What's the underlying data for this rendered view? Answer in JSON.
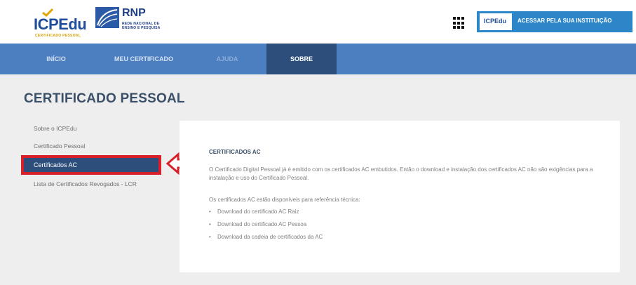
{
  "header": {
    "logo_icp_text": "ICPEdu",
    "logo_icp_sub": "CERTIFICADO PESSOAL",
    "logo_rnp_text": "RNP",
    "logo_rnp_sub1": "REDE NACIONAL DE",
    "logo_rnp_sub2": "ENSINO E PESQUISA",
    "login_logo_text": "ICPEdu",
    "login_label": "ACESSAR PELA SUA INSTITUIÇÃO",
    "grid_icon": "apps-grid-icon"
  },
  "nav": {
    "items": [
      {
        "label": "INÍCIO"
      },
      {
        "label": "MEU CERTIFICADO"
      },
      {
        "label": "AJUDA"
      },
      {
        "label": "SOBRE"
      }
    ]
  },
  "page_title": "CERTIFICADO PESSOAL",
  "sidebar": {
    "items": [
      {
        "label": "Sobre o ICPEdu"
      },
      {
        "label": "Certificado Pessoal"
      },
      {
        "label": "Certificados AC"
      },
      {
        "label": "Lista de Certificados Revogados - LCR"
      }
    ]
  },
  "content": {
    "heading": "CERTIFICADOS AC",
    "paragraph": "O Certificado Digital Pessoal já é emitido com os certificados AC embutidos. Então o download e instalação dos certificados AC não são exigências para a instalação e uso do Certificado Pessoal.",
    "paragraph2": "Os certificados AC estão disponíveis para referência técnica:",
    "links": [
      {
        "label": "Download do certificado AC Raiz"
      },
      {
        "label": "Download do certificado AC Pessoa"
      },
      {
        "label": "Download da cadeia de certificados da AC"
      }
    ]
  },
  "colors": {
    "nav_bg": "#4c7fc0",
    "nav_active_bg": "#2d4e7a",
    "highlight_red": "#d8202a",
    "login_btn_bg": "#2d86c8"
  }
}
